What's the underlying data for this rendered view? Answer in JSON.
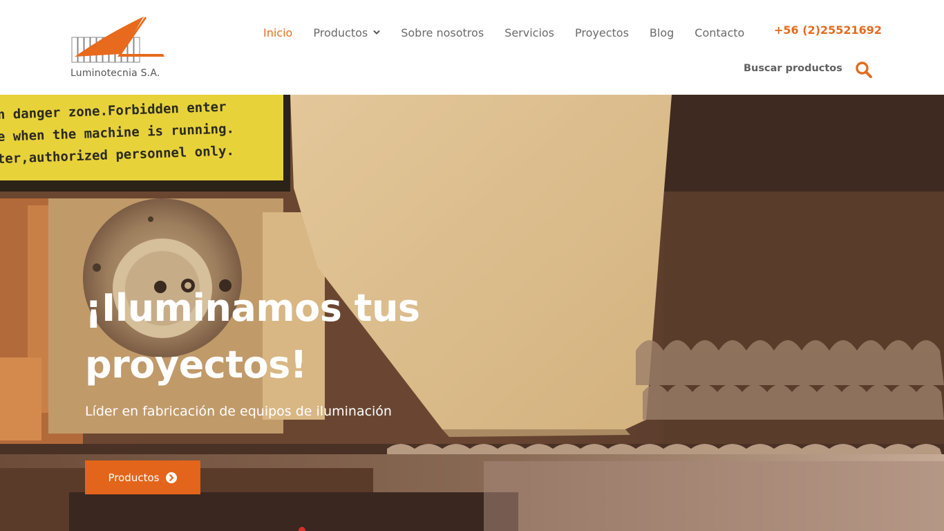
{
  "brand": {
    "name": "Luminotecnia S.A.",
    "accent": "#e36b1e"
  },
  "nav": {
    "items": [
      {
        "label": "Inicio",
        "active": true
      },
      {
        "label": "Productos",
        "has_dropdown": true
      },
      {
        "label": "Sobre nosotros"
      },
      {
        "label": "Servicios"
      },
      {
        "label": "Proyectos"
      },
      {
        "label": "Blog"
      },
      {
        "label": "Contacto"
      }
    ],
    "phone": "+56 (2)25521692",
    "search_label": "Buscar productos"
  },
  "hero": {
    "title": "¡Iluminamos tus proyectos!",
    "subtitle": "Líder en fabricación de equipos de iluminación",
    "button_label": "Productos",
    "sign_lines": [
      "n danger zone.Forbidden enter",
      "e when the machine is running.",
      "ter,authorized personnel only."
    ]
  }
}
